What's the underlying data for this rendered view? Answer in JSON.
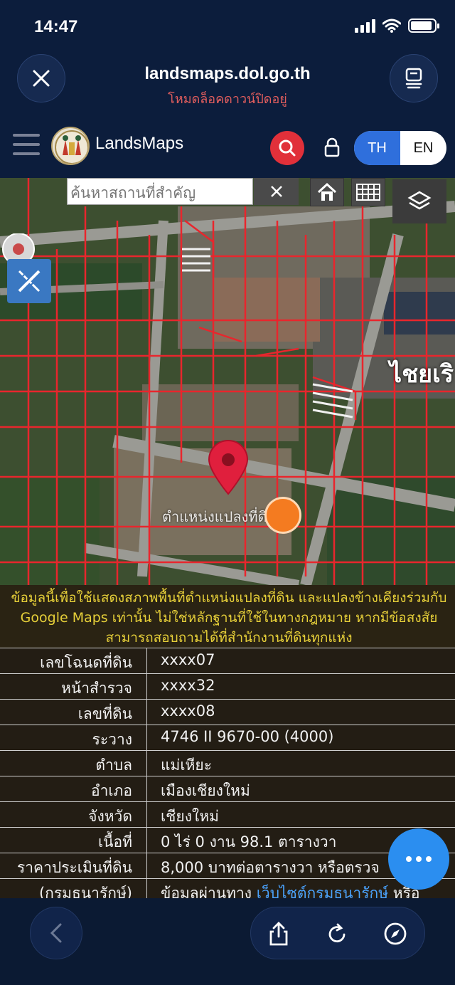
{
  "status_bar": {
    "time": "14:47"
  },
  "browser": {
    "host": "landsmaps.dol.go.th",
    "mode": "โหมดล็อคดาวน์ปิดอยู่"
  },
  "app_header": {
    "brand": "LandsMaps",
    "lang_th": "TH",
    "lang_en": "EN",
    "active_lang": "TH"
  },
  "map": {
    "search_placeholder": "ค้นหาสถานที่สำคัญ",
    "place_label": "ตำแหน่งแปลงที่ดิน",
    "road_label": "ไชยเริ"
  },
  "notice": "ข้อมูลนี้เพื่อใช้แสดงสภาพพื้นที่ตำแหน่งแปลงที่ดิน และแปลงข้างเคียงร่วมกับ Google Maps เท่านั้น ไม่ใช่หลักฐานที่ใช้ในทางกฎหมาย หากมีข้อสงสัยสามารถสอบถามได้ที่สำนักงานที่ดินทุกแห่ง",
  "parcel": {
    "rows": [
      {
        "label": "เลขโฉนดที่ดิน",
        "value": "xxxx07"
      },
      {
        "label": "หน้าสำรวจ",
        "value": "xxxx32"
      },
      {
        "label": "เลขที่ดิน",
        "value": "xxxx08"
      },
      {
        "label": "ระวาง",
        "value": "4746 II 9670-00 (4000)"
      },
      {
        "label": "ตำบล",
        "value": "แม่เหียะ"
      },
      {
        "label": "อำเภอ",
        "value": "เมืองเชียงใหม่"
      },
      {
        "label": "จังหวัด",
        "value": "เชียงใหม่"
      },
      {
        "label": "เนื้อที่",
        "value": "0 ไร่ 0 งาน 98.1 ตารางวา"
      },
      {
        "label": "ราคาประเมินที่ดิน",
        "value": "8,000 บาทต่อตารางวา หรือตรวจ"
      }
    ],
    "last_label": "(กรมธนารักษ์)",
    "last_prefix": "ข้อมูลผ่านทาง",
    "last_link": "เว็บไซต์กรมธนารักษ์",
    "last_suffix": "หรือ"
  },
  "icons": {
    "close": "close-icon",
    "tabs": "tabs-icon",
    "menu": "hamburger-menu-icon",
    "search": "search-icon",
    "lock": "lock-icon",
    "home": "home-icon",
    "grid": "grid-icon",
    "layers": "layers-icon",
    "pin": "location-pin-icon",
    "more": "more-icon",
    "back": "chevron-left-icon",
    "share": "share-icon",
    "reload": "reload-icon",
    "compass": "compass-icon"
  },
  "colors": {
    "header_bg": "#0c1d3c",
    "accent_red": "#e1303a",
    "accent_blue": "#2f6fdc",
    "notice_text": "#e6cf39",
    "parcel_lines": "#e8262d"
  }
}
